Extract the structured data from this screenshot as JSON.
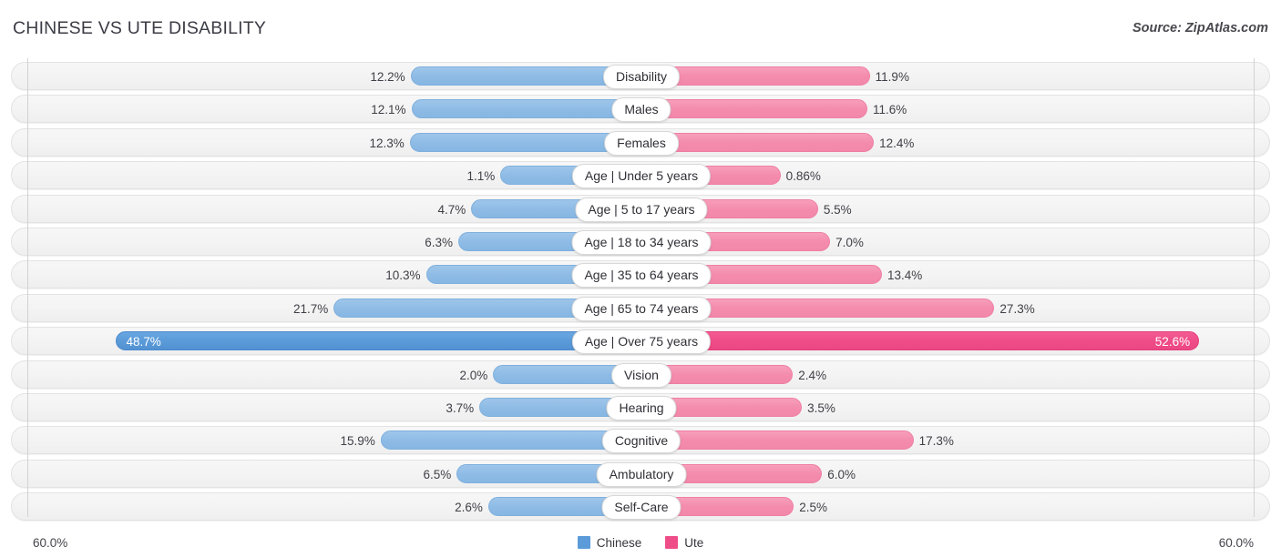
{
  "header": {
    "title": "CHINESE VS UTE DISABILITY",
    "source": "Source: ZipAtlas.com"
  },
  "axis": {
    "left_label": "60.0%",
    "right_label": "60.0%"
  },
  "legend": {
    "items": [
      {
        "label": "Chinese",
        "color": "#5b9bd9"
      },
      {
        "label": "Ute",
        "color": "#ef4d88"
      }
    ]
  },
  "chart_data": {
    "type": "bar",
    "subtype": "diverging-bidirectional",
    "title": "CHINESE VS UTE DISABILITY",
    "xlabel": "",
    "ylabel": "",
    "xlim": [
      60.0,
      60.0
    ],
    "grid": true,
    "legend_position": "bottom-center",
    "categories": [
      "Disability",
      "Males",
      "Females",
      "Age | Under 5 years",
      "Age | 5 to 17 years",
      "Age | 18 to 34 years",
      "Age | 35 to 64 years",
      "Age | 65 to 74 years",
      "Age | Over 75 years",
      "Vision",
      "Hearing",
      "Cognitive",
      "Ambulatory",
      "Self-Care"
    ],
    "series": [
      {
        "name": "Chinese",
        "color": "#8fbce6",
        "highlight_color": "#5b9bd9",
        "values": [
          12.2,
          12.1,
          12.3,
          1.1,
          4.7,
          6.3,
          10.3,
          21.7,
          48.7,
          2.0,
          3.7,
          15.9,
          6.5,
          2.6
        ],
        "labels": [
          "12.2%",
          "12.1%",
          "12.3%",
          "1.1%",
          "4.7%",
          "6.3%",
          "10.3%",
          "21.7%",
          "48.7%",
          "2.0%",
          "3.7%",
          "15.9%",
          "6.5%",
          "2.6%"
        ]
      },
      {
        "name": "Ute",
        "color": "#f48cae",
        "highlight_color": "#ef4d88",
        "values": [
          11.9,
          11.6,
          12.4,
          0.86,
          5.5,
          7.0,
          13.4,
          27.3,
          52.6,
          2.4,
          3.5,
          17.3,
          6.0,
          2.5
        ],
        "labels": [
          "11.9%",
          "11.6%",
          "12.4%",
          "0.86%",
          "5.5%",
          "7.0%",
          "13.4%",
          "27.3%",
          "52.6%",
          "2.4%",
          "3.5%",
          "17.3%",
          "6.0%",
          "2.5%"
        ]
      }
    ],
    "highlighted_row": "Age | Over 75 years"
  }
}
